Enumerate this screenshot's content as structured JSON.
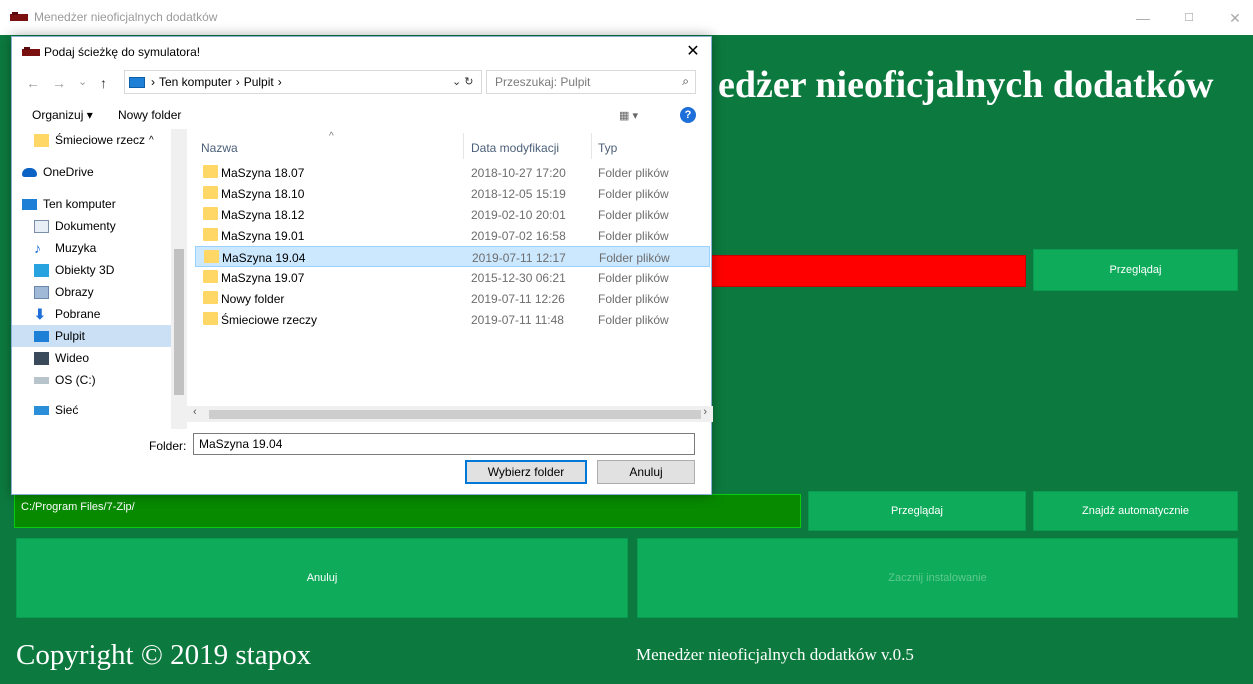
{
  "window": {
    "title": "Menedżer nieoficjalnych dodatków",
    "minimize": "—",
    "maximize": "☐",
    "close": "✕"
  },
  "app": {
    "heading": "edżer nieoficjalnych dodatków",
    "browse_top_label": "Przeglądaj",
    "path_value": "C:/Program Files/7-Zip/",
    "browse_bottom_label": "Przeglądaj",
    "auto_find_label": "Znajdź automatycznie",
    "cancel_label": "Anuluj",
    "install_label": "Zacznij instalowanie",
    "copyright": "Copyright © 2019 stapox",
    "version": "Menedżer nieoficjalnych dodatków v.0.5",
    "colors": {
      "background": "#0c7a3e",
      "button": "#0dab5a",
      "error_bar": "#ff0000",
      "path_field": "#078a00"
    }
  },
  "dialog": {
    "title": "Podaj ścieżkę do symulatora!",
    "close": "✕",
    "nav": {
      "back": "←",
      "forward": "→",
      "dropdown": "⌄",
      "up": "↑"
    },
    "breadcrumb": [
      "Ten komputer",
      "Pulpit"
    ],
    "breadcrumb_sep": "›",
    "addr_tail": "⌄  ↻",
    "search_placeholder": "Przeszukaj: Pulpit",
    "search_icon": "⌕",
    "toolbar": {
      "organize": "Organizuj ▾",
      "new_folder": "Nowy folder",
      "view": "▦ ▾",
      "help": "?"
    },
    "nav_items": [
      {
        "label": "Śmieciowe rzecz",
        "icon": "folder-icon"
      },
      {
        "label": "OneDrive",
        "icon": "cloud-icon"
      },
      {
        "label": "Ten komputer",
        "icon": "computer-icon"
      },
      {
        "label": "Dokumenty",
        "icon": "document-icon"
      },
      {
        "label": "Muzyka",
        "icon": "music-icon"
      },
      {
        "label": "Obiekty 3D",
        "icon": "cube-icon"
      },
      {
        "label": "Obrazy",
        "icon": "image-icon"
      },
      {
        "label": "Pobrane",
        "icon": "download-icon"
      },
      {
        "label": "Pulpit",
        "icon": "desktop-icon",
        "selected": true
      },
      {
        "label": "Wideo",
        "icon": "video-icon"
      },
      {
        "label": "OS (C:)",
        "icon": "drive-icon"
      },
      {
        "label": "Sieć",
        "icon": "network-icon"
      }
    ],
    "columns": {
      "name": "Nazwa",
      "date": "Data modyfikacji",
      "type": "Typ"
    },
    "files": [
      {
        "name": "MaSzyna 18.07",
        "date": "2018-10-27 17:20",
        "type": "Folder plików"
      },
      {
        "name": "MaSzyna 18.10",
        "date": "2018-12-05 15:19",
        "type": "Folder plików"
      },
      {
        "name": "MaSzyna 18.12",
        "date": "2019-02-10 20:01",
        "type": "Folder plików"
      },
      {
        "name": "MaSzyna 19.01",
        "date": "2019-07-02 16:58",
        "type": "Folder plików"
      },
      {
        "name": "MaSzyna 19.04",
        "date": "2019-07-11 12:17",
        "type": "Folder plików",
        "selected": true
      },
      {
        "name": "MaSzyna 19.07",
        "date": "2015-12-30 06:21",
        "type": "Folder plików"
      },
      {
        "name": "Nowy folder",
        "date": "2019-07-11 12:26",
        "type": "Folder plików"
      },
      {
        "name": "Śmieciowe rzeczy",
        "date": "2019-07-11 11:48",
        "type": "Folder plików"
      }
    ],
    "folder_label": "Folder:",
    "folder_value": "MaSzyna 19.04",
    "select_label": "Wybierz folder",
    "cancel_label": "Anuluj"
  }
}
